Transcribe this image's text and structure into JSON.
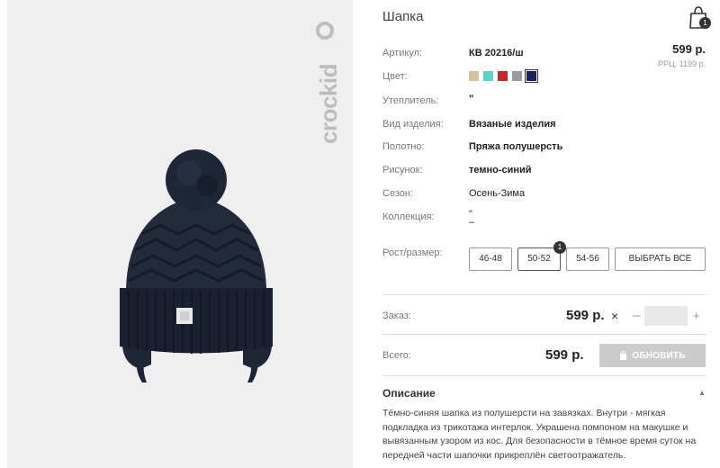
{
  "product": {
    "title": "Шапка",
    "price": "599 р.",
    "rrp": "РРЦ: 1199 р.",
    "brand_logo_text": "crockid"
  },
  "cart": {
    "icon": "shopping-bag-icon",
    "count": "1"
  },
  "specs": {
    "article_label": "Артикул:",
    "article_value": "КВ 20216/ш",
    "color_label": "Цвет:",
    "insulation_label": "Утеплитель:",
    "insulation_value": "\"",
    "type_label": "Вид изделия:",
    "type_value": "Вязаные изделия",
    "fabric_label": "Полотно:",
    "fabric_value": "Пряжа полушерсть",
    "pattern_label": "Рисунок:",
    "pattern_value": "темно-синий",
    "season_label": "Сезон:",
    "season_value": "Осень-Зима",
    "collection_label": "Коллекция:",
    "collection_value_1": "\"",
    "collection_value_2": "–"
  },
  "colors": [
    "#d6c2a3",
    "#5fd2c7",
    "#c8252d",
    "#9a9a9a",
    "#1c1f5e"
  ],
  "selected_color_index": 4,
  "sizes": {
    "label": "Рост/размер:",
    "options": [
      "46-48",
      "50-52",
      "54-56"
    ],
    "select_all": "ВЫБРАТЬ ВСЕ",
    "selected_badge": "1"
  },
  "order": {
    "label": "Заказ:",
    "price": "599 р.",
    "remove_icon": "×",
    "minus": "–",
    "plus": "+",
    "quantity": ""
  },
  "total": {
    "label": "Всего:",
    "price": "599 р.",
    "update_button": "ОБНОВИТЬ"
  },
  "description": {
    "title": "Описание",
    "text": "Тёмно-синяя шапка из полушерсти на завязках. Внутри - мягкая подкладка из трикотажа интерлок. Украшена помпоном на макушке и вывязанным узором из кос. Для безопасности в тёмное время суток на передней части шапочки прикреплён светоотражатель."
  }
}
